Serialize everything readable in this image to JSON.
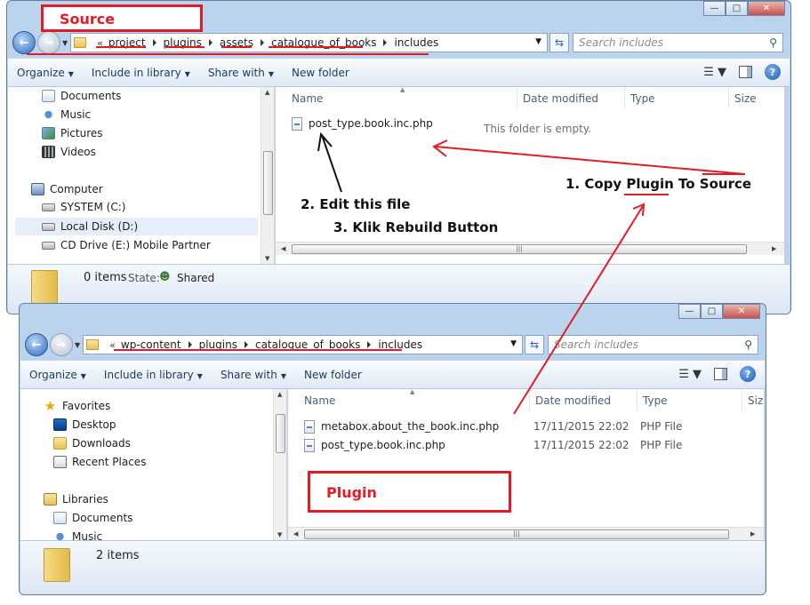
{
  "source_window": {
    "breadcrumb": [
      "project",
      "plugins",
      "assets",
      "catalogue_of_books",
      "includes"
    ],
    "search_placeholder": "Search includes",
    "toolbar": {
      "organize": "Organize",
      "include": "Include in library",
      "share": "Share with",
      "new_folder": "New folder"
    },
    "nav_items": [
      {
        "label": "Documents",
        "icon": "documents-icon"
      },
      {
        "label": "Music",
        "icon": "music-icon"
      },
      {
        "label": "Pictures",
        "icon": "pictures-icon"
      },
      {
        "label": "Videos",
        "icon": "videos-icon"
      },
      {
        "label": "Computer",
        "icon": "computer-icon"
      },
      {
        "label": "SYSTEM (C:)",
        "icon": "drive-icon"
      },
      {
        "label": "Local Disk (D:)",
        "icon": "drive-icon"
      },
      {
        "label": "CD Drive (E:) Mobile Partner",
        "icon": "cd-drive-icon"
      }
    ],
    "columns": {
      "name": "Name",
      "date": "Date modified",
      "type": "Type",
      "size": "Size"
    },
    "files": [
      {
        "name": "post_type.book.inc.php"
      }
    ],
    "empty_text": "This folder is empty.",
    "status": {
      "count": "0 items",
      "state_label": "State:",
      "state_value": "Shared"
    }
  },
  "plugin_window": {
    "breadcrumb": [
      "wp-content",
      "plugins",
      "catalogue_of_books",
      "includes"
    ],
    "search_placeholder": "Search includes",
    "toolbar": {
      "organize": "Organize",
      "include": "Include in library",
      "share": "Share with",
      "new_folder": "New folder"
    },
    "nav_items": [
      {
        "label": "Favorites",
        "icon": "star-icon"
      },
      {
        "label": "Desktop",
        "icon": "desktop-icon"
      },
      {
        "label": "Downloads",
        "icon": "downloads-folder-icon"
      },
      {
        "label": "Recent Places",
        "icon": "recent-places-icon"
      },
      {
        "label": "Libraries",
        "icon": "libraries-icon"
      },
      {
        "label": "Documents",
        "icon": "documents-icon"
      },
      {
        "label": "Music",
        "icon": "music-icon"
      }
    ],
    "columns": {
      "name": "Name",
      "date": "Date modified",
      "type": "Type",
      "size": "Siz"
    },
    "files": [
      {
        "name": "metabox.about_the_book.inc.php",
        "date": "17/11/2015 22:02",
        "type": "PHP File"
      },
      {
        "name": "post_type.book.inc.php",
        "date": "17/11/2015 22:02",
        "type": "PHP File"
      }
    ],
    "status": {
      "count": "2 items"
    }
  },
  "annotations": {
    "source_label": "Source",
    "plugin_label": "Plugin",
    "step1_prefix": "1. Copy ",
    "step1_plugin": "Plugin",
    "step1_suffix": " To Source",
    "step2": "2. Edit this file",
    "step3": "3. Klik Rebuild Button"
  },
  "colors": {
    "annotation_red": "#e21b24",
    "window_frame": "#bcd3ee",
    "accent": "#2d6bc0"
  }
}
